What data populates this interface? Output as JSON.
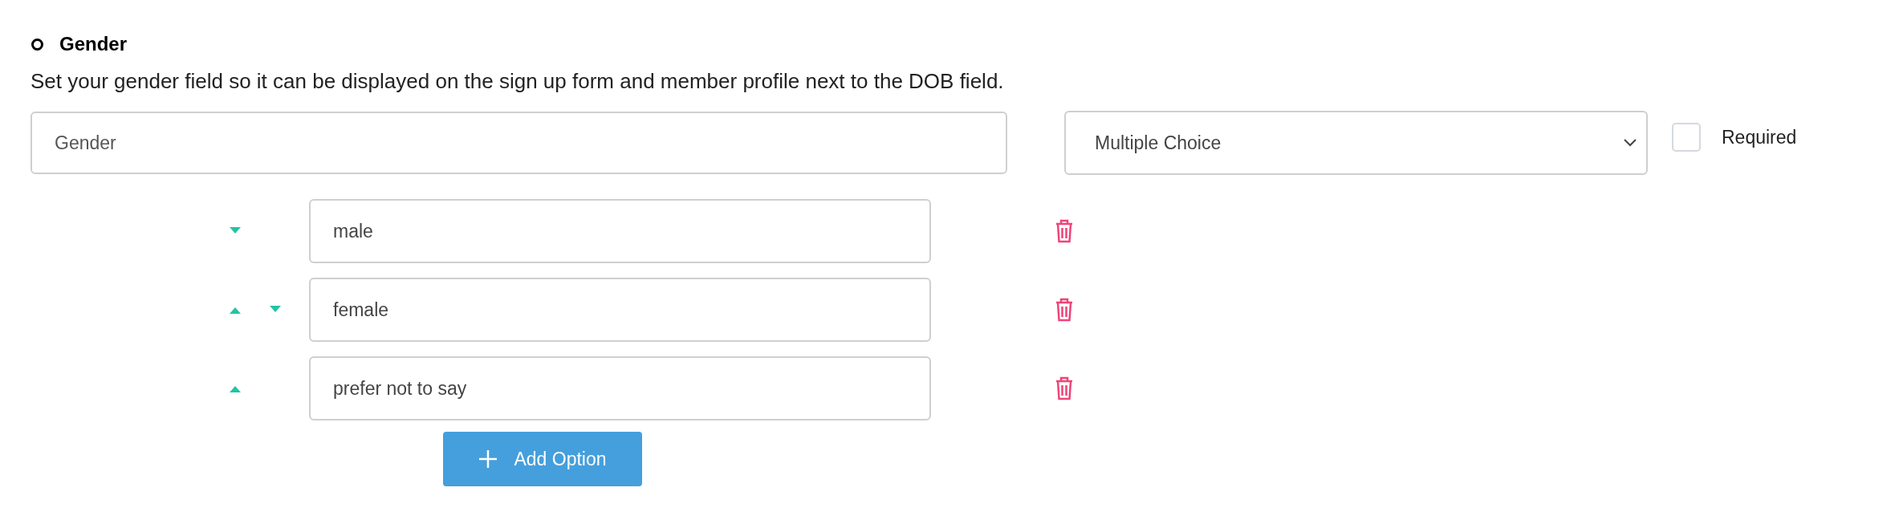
{
  "section": {
    "title": "Gender",
    "description": "Set your gender field so it can be displayed on the sign up form and member profile next to the DOB field."
  },
  "field_name": {
    "value": "Gender"
  },
  "field_type": {
    "value": "Multiple Choice"
  },
  "required": {
    "label": "Required",
    "checked": false
  },
  "options": [
    {
      "value": "male",
      "move_up": false,
      "move_down": true
    },
    {
      "value": "female",
      "move_up": true,
      "move_down": true
    },
    {
      "value": "prefer not to say",
      "move_up": true,
      "move_down": false
    }
  ],
  "add_button": {
    "label": "Add Option"
  }
}
